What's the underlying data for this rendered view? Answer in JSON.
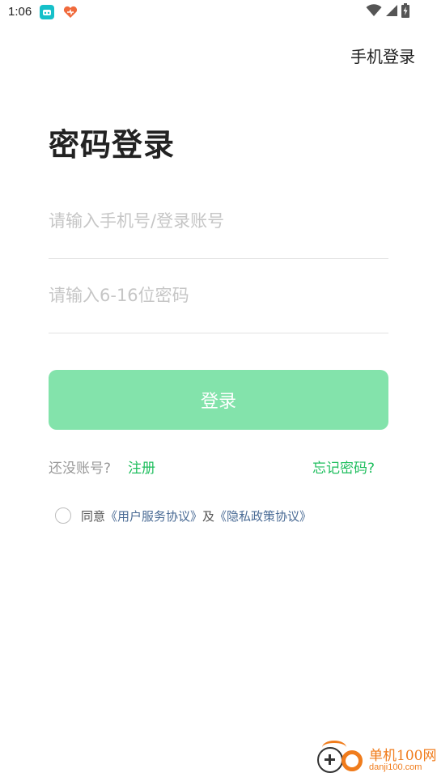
{
  "status_bar": {
    "time": "1:06",
    "icons": [
      "app-notification-icon",
      "heart-notification-icon",
      "wifi-icon",
      "cellular-signal-icon",
      "battery-charging-icon"
    ]
  },
  "header": {
    "switch_mode_label": "手机登录"
  },
  "page": {
    "title": "密码登录"
  },
  "form": {
    "account_placeholder": "请输入手机号/登录账号",
    "account_value": "",
    "password_placeholder": "请输入6-16位密码",
    "password_value": "",
    "login_label": "登录"
  },
  "links": {
    "no_account_text": "还没账号?",
    "register_label": "注册",
    "forgot_label": "忘记密码?"
  },
  "agreement": {
    "prefix": "同意",
    "user_agreement": "《用户服务协议》",
    "and": "及",
    "privacy_policy": "《隐私政策协议》"
  },
  "watermark": {
    "name": "单机100网",
    "url": "danji100.com"
  },
  "colors": {
    "accent": "#1fbe5e",
    "button_disabled": "#83e3ab",
    "link_blue": "#4a6b95",
    "watermark_orange": "#f07c1c"
  }
}
